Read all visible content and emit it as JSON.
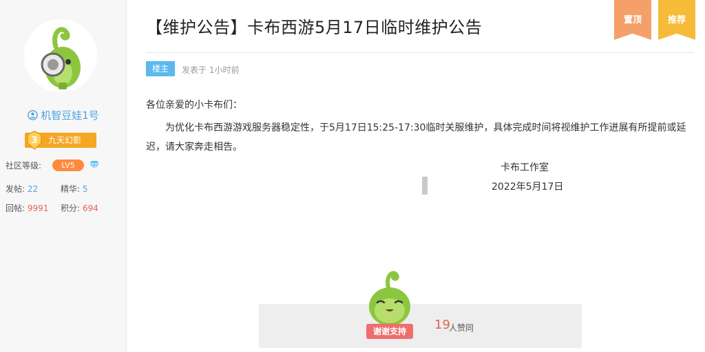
{
  "user": {
    "name": "机智豆娃1号",
    "rank_number": "3",
    "rank_title": "九天幻影",
    "level_label": "社区等级:",
    "level_value": "LV5",
    "stats": {
      "posts_label": "发帖:",
      "posts_value": "22",
      "elite_label": "精华:",
      "elite_value": "5",
      "replies_label": "回帖:",
      "replies_value": "9991",
      "points_label": "积分:",
      "points_value": "694"
    }
  },
  "post": {
    "title": "【维护公告】卡布西游5月17日临时维护公告",
    "pin_label": "置顶",
    "recommend_label": "推荐",
    "op_tag": "楼主",
    "post_time": "发表于 1小时前",
    "greeting": "各位亲爱的小卡布们：",
    "paragraph": "为优化卡布西游游戏服务器稳定性，于5月17日15:25-17:30临时关服维护，具体完成时间将视维护工作进展有所提前或延迟，请大家奔走相告。",
    "signature_team": "卡布工作室",
    "signature_date": "2022年5月17日"
  },
  "likes": {
    "button_label": "谢谢支持",
    "count": "19",
    "suffix": "人赞同"
  },
  "colors": {
    "accent_blue": "#4aa3df",
    "rank_orange": "#f5a623",
    "level_orange": "#ff8a3d",
    "pin_ribbon": "#f5a06a",
    "recommend_ribbon": "#f7bb3a",
    "like_red": "#e0654e"
  },
  "icons": [
    "user-icon",
    "rank-medal-icon",
    "diamond-icon",
    "mascot-avatar",
    "mascot-like"
  ]
}
